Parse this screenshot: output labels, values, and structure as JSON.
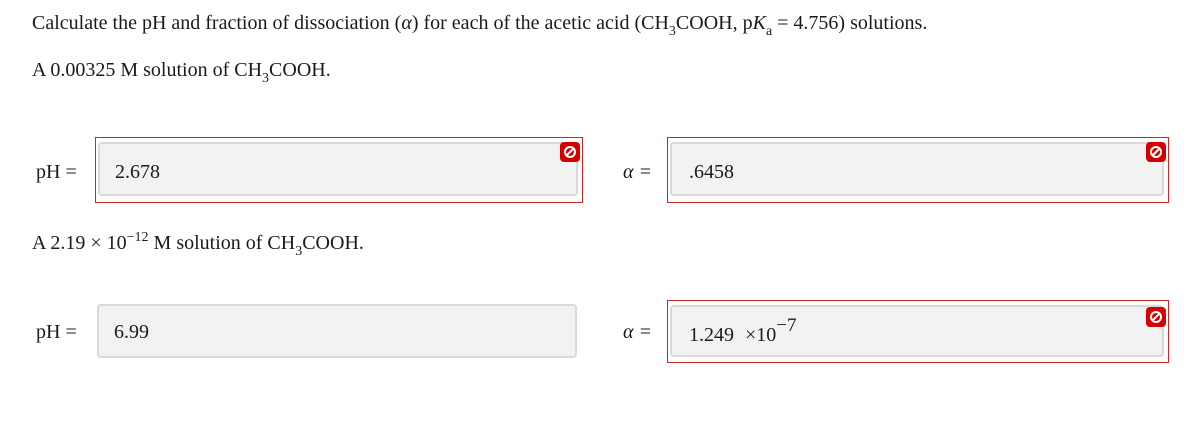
{
  "question": {
    "part1": "Calculate the pH and fraction of dissociation (",
    "alpha": "α",
    "part2": ") for each of the acetic acid (CH",
    "sub3": "3",
    "part3": "COOH, p",
    "K": "K",
    "Ksub": "a",
    "part4": " = 4.756) solutions."
  },
  "problem1": {
    "label_prefix": "A 0.00325 M solution of CH",
    "label_sub": "3",
    "label_suffix": "COOH.",
    "ph_label": "pH =",
    "ph_value": "2.678",
    "ph_status": "incorrect",
    "alpha_label": "α =",
    "alpha_value": ".6458",
    "alpha_status": "incorrect"
  },
  "problem2": {
    "label_prefix": "A 2.19 × 10",
    "label_exp": "−12",
    "label_mid": " M solution of CH",
    "label_sub": "3",
    "label_suffix": "COOH.",
    "ph_label": "pH =",
    "ph_value": "6.99",
    "ph_status": "unmarked",
    "alpha_label": "α =",
    "alpha_mantissa": "1.249",
    "alpha_times": "×10",
    "alpha_exp": "−7",
    "alpha_status": "incorrect"
  },
  "icons": {
    "wrong": "prohibited-icon"
  },
  "colors": {
    "incorrect_border": "#c62828",
    "incorrect_icon": "#d50000",
    "input_background": "#f2f2f2",
    "input_border": "#d9d9d9"
  }
}
